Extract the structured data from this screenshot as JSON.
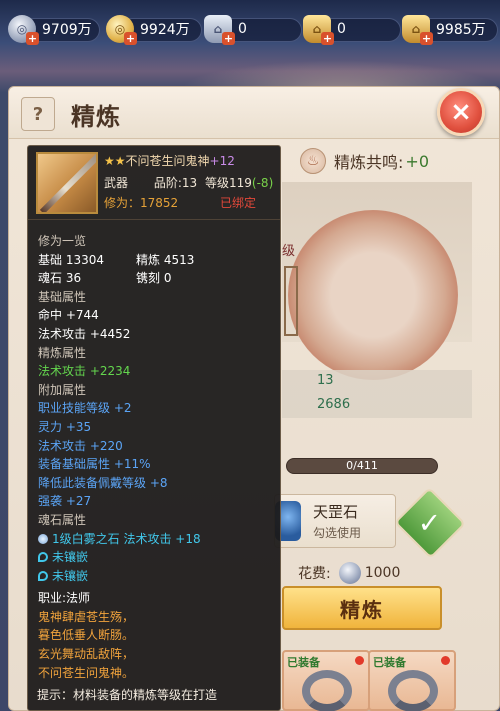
{
  "currencies": [
    {
      "name": "silver-coin",
      "value": "9709万",
      "color": "#9ba6bd"
    },
    {
      "name": "gold-coin",
      "value": "9924万",
      "color": "#e1b24a"
    },
    {
      "name": "silver-ingot",
      "value": "0",
      "color": "#8f9ab3"
    },
    {
      "name": "gold-ingot",
      "value": "0",
      "color": "#c28b2c"
    },
    {
      "name": "gold-ingot-2",
      "value": "9985万",
      "color": "#c28b2c"
    }
  ],
  "panel": {
    "help_label": "?",
    "title": "精炼",
    "close_label": "×",
    "resonance_label": "精炼共鸣:",
    "resonance_value": "+0",
    "preview_level_tag": "级",
    "preview_stat_1": "13",
    "preview_stat_2": "2686",
    "progress_text": "0/411",
    "material_name": "天罡石",
    "material_hint": "勾选使用",
    "cost_label": "花费:",
    "cost_value": "1000",
    "refine_button": "精炼",
    "slot_tag": "已装备"
  },
  "tooltip": {
    "stars": "★★",
    "item_name": "不问苍生问鬼神",
    "item_plus": "+12",
    "type": "武器",
    "quality_label": "品阶:13",
    "level_label": "等级",
    "level_value": "119",
    "level_delta": "(-8)",
    "cultivation": "修为：17852",
    "bound": "已绑定",
    "sec_overview": "修为一览",
    "base_label": "基础 13304",
    "refine_label": "精炼 4513",
    "soulstone_label": "魂石 36",
    "engrave_label": "镌刻 0",
    "sec_base_attr": "基础属性",
    "base_attr_1": "命中 +744",
    "base_attr_2": "法术攻击 +4452",
    "sec_refine_attr": "精炼属性",
    "refine_attr_1": "法术攻击 +2234",
    "sec_extra_attr": "附加属性",
    "extra_attrs": [
      "职业技能等级 +2",
      "灵力 +35",
      "法术攻击 +220",
      "装备基础属性 +11%",
      "降低此装备佩戴等级 +8",
      "强袭 +27"
    ],
    "sec_soulstone": "魂石属性",
    "soulstone_1": "1级白雾之石 法术攻击 +18",
    "soulstone_2": "未镶嵌",
    "soulstone_3": "未镶嵌",
    "profession": "职业:法师",
    "poem": [
      "鬼神肆虐苍生殇，",
      "暮色低垂人断肠。",
      "玄光舞动乱敌阵，",
      "不问苍生问鬼神。"
    ],
    "tip": "提示：材料装备的精炼等级在打造"
  }
}
